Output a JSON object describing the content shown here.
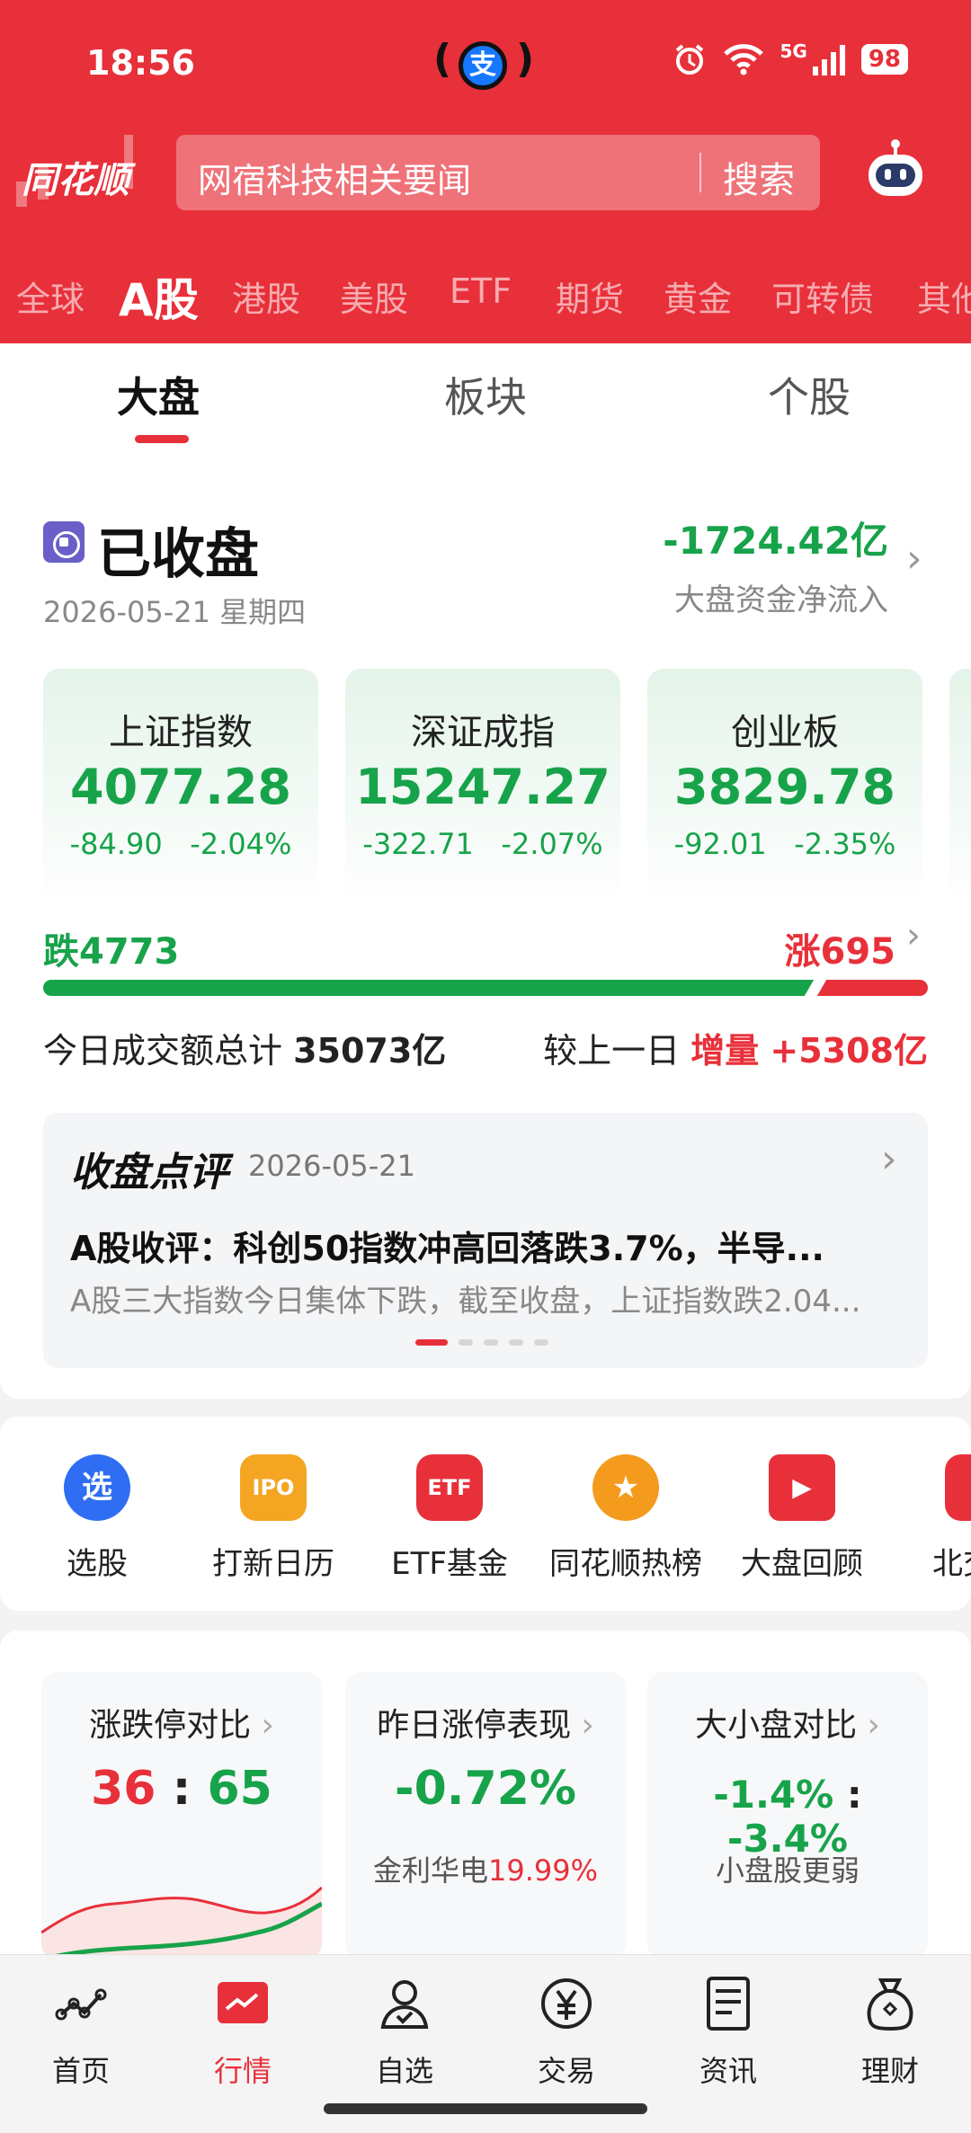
{
  "status_bar": {
    "time": "18:56",
    "alipay_glyph": "支",
    "network": "5G",
    "battery": "98"
  },
  "header": {
    "logo": "同花顺",
    "search_placeholder": "网宿科技相关要闻",
    "search_button": "搜索",
    "market_tabs": [
      "全球",
      "A股",
      "港股",
      "美股",
      "ETF",
      "期货",
      "黄金",
      "可转债",
      "其他"
    ],
    "active_market_tab": "A股",
    "accent_color": "#e8303a"
  },
  "subtabs": {
    "items": [
      "大盘",
      "板块",
      "个股"
    ],
    "active": "大盘"
  },
  "market_status": {
    "title": "已收盘",
    "date": "2026-05-21 星期四",
    "net_flow_value": "-1724.42亿",
    "net_flow_label": "大盘资金净流入"
  },
  "indices": [
    {
      "name": "上证指数",
      "value": "4077.28",
      "change": "-84.90",
      "pct": "-2.04%"
    },
    {
      "name": "深证成指",
      "value": "15247.27",
      "change": "-322.71",
      "pct": "-2.07%"
    },
    {
      "name": "创业板",
      "value": "3829.78",
      "change": "-92.01",
      "pct": "-2.35%"
    }
  ],
  "breadth": {
    "fall_label": "跌4773",
    "rise_label": "涨695",
    "fall": 4773,
    "rise": 695
  },
  "turnover": {
    "label": "今日成交额总计",
    "value": "35073亿",
    "compare_label": "较上一日",
    "increase_label": "增量",
    "increase_value": "+5308亿"
  },
  "review": {
    "brand": "收盘点评",
    "date": "2026-05-21",
    "title": "A股收评：科创50指数冲高回落跌3.7%，半导...",
    "summary": "A股三大指数今日集体下跌，截至收盘，上证指数跌2.04..."
  },
  "shortcuts": [
    {
      "label": "选股",
      "icon": "select-stock-icon",
      "glyph": "选"
    },
    {
      "label": "打新日历",
      "icon": "ipo-calendar-icon",
      "glyph": "IPO"
    },
    {
      "label": "ETF基金",
      "icon": "etf-fund-icon",
      "glyph": "ETF"
    },
    {
      "label": "同花顺热榜",
      "icon": "hot-list-icon",
      "glyph": "★"
    },
    {
      "label": "大盘回顾",
      "icon": "market-review-icon",
      "glyph": "▶"
    },
    {
      "label": "北交所",
      "icon": "bse-icon",
      "glyph": ""
    }
  ],
  "stats": {
    "limit_compare": {
      "title": "涨跌停对比",
      "up": "36",
      "sep": ":",
      "down": "65"
    },
    "yesterday_limit": {
      "title": "昨日涨停表现",
      "value": "-0.72%",
      "stock": "金利华电",
      "stock_pct": "19.99%"
    },
    "size_compare": {
      "title": "大小盘对比",
      "large": "-1.4%",
      "sep": ":",
      "small": "-3.4%",
      "note": "小盘股更弱"
    }
  },
  "bottom_nav": {
    "items": [
      "首页",
      "行情",
      "自选",
      "交易",
      "资讯",
      "理财"
    ],
    "active": "行情"
  }
}
